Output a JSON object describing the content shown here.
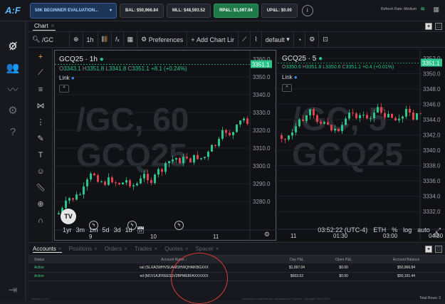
{
  "topbar": {
    "logo": "A:F",
    "account": "50K BEGINNER EVALUATION...",
    "bal": "BAL: $50,966.84",
    "mll": "MLL: $48,593.52",
    "rpl": "RP&L: $1,097.04",
    "upl": "UP&L: $0.00",
    "refresh": "Refresh Rate: Medium"
  },
  "chart_panel": {
    "tab": "Chart",
    "symbol": "/GC",
    "interval": "1h",
    "preferences": "Preferences",
    "add_chart": "Add Chart Lir",
    "layout": "default"
  },
  "left_pane": {
    "title": "GCQ25 · 1h",
    "o": "3343.1",
    "h": "3351.8",
    "l": "3341.8",
    "c": "3351.1",
    "change": "+8.1 (+0.24%)",
    "link": "Link",
    "watermark1": "/GC, 60",
    "watermark2": "GCQ25",
    "price_tag": "3351.1",
    "yticks": [
      "3360.0",
      "3350.0",
      "3340.0",
      "3330.0",
      "3320.0",
      "3310.0",
      "3300.0",
      "3290.0",
      "3280.0"
    ],
    "xticks": [
      "9",
      "10",
      "11"
    ]
  },
  "right_pane": {
    "title": "GCQ25 · 5",
    "o": "3350.6",
    "h": "3351.8",
    "l": "3350.6",
    "c": "3351.1",
    "change": "+0.4 (+0.01%)",
    "link": "Link",
    "watermark1": "/GC, 5",
    "watermark2": "GCQ25",
    "price_tag": "3351.1",
    "yticks": [
      "3352.0",
      "3350.0",
      "3348.0",
      "3346.0",
      "3344.0",
      "3342.0",
      "3340.0",
      "3338.0",
      "3336.0",
      "3334.0",
      "3332.0"
    ],
    "xticks": [
      "11",
      "01:30",
      "03:00",
      "04:30"
    ]
  },
  "bottombar": {
    "ranges": [
      "1yr",
      "3m",
      "1m",
      "5d",
      "3d",
      "1d"
    ],
    "time": "03:52:22 (UTC-4)",
    "exchange": "ETH",
    "pct": "%",
    "log": "log",
    "auto": "auto"
  },
  "account_panel": {
    "tabs": [
      "Accounts",
      "Positions",
      "Orders",
      "Trades",
      "Quotes",
      "Spacer"
    ],
    "columns": [
      "Status",
      "Account Name",
      "Day P&L",
      "Open P&L",
      "Account Balance"
    ],
    "rows": [
      {
        "status": "Active",
        "name": "val (SLXAOWHVSUAMSHWQHAIKBGXXX",
        "day": "$1,097.04",
        "open": "$0.00",
        "balance": "$50,966.84"
      },
      {
        "status": "Active",
        "name": "ed (M1V1AJFREES1V2BPME8FAXXXXXX",
        "day": "$603.52",
        "open": "$0.00",
        "balance": "$50,191.44"
      }
    ],
    "footer_left": "Version 1.10.1",
    "footer_mid": "Licensed to AmpFutures. Accessed by ProjectX. Copyright 2024-2025",
    "footer_right": "Total Rows: 2"
  },
  "colors": {
    "up": "#2bc48a",
    "down": "#e0434f",
    "accent": "#1f7a4a"
  }
}
